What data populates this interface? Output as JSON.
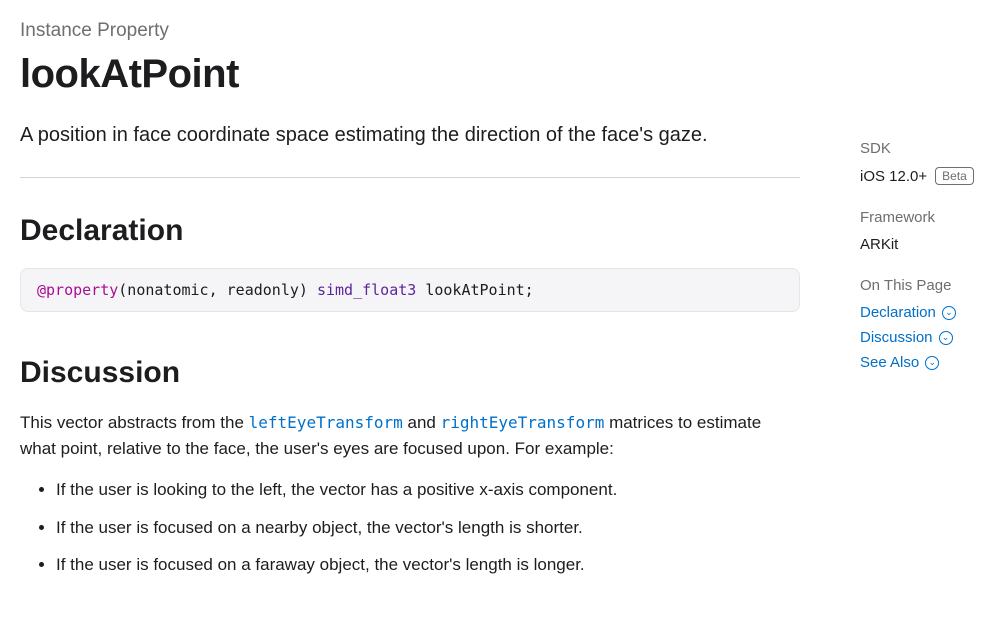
{
  "eyebrow": "Instance Property",
  "title": "lookAtPoint",
  "summary": "A position in face coordinate space estimating the direction of the face's gaze.",
  "sections": {
    "declaration": {
      "heading": "Declaration",
      "code": {
        "keyword": "@property",
        "modifiers": "(nonatomic, readonly) ",
        "type": "simd_float3",
        "rest": " lookAtPoint;"
      }
    },
    "discussion": {
      "heading": "Discussion",
      "intro_pre": "This vector abstracts from the ",
      "link1": "leftEyeTransform",
      "intro_mid": " and ",
      "link2": "rightEyeTransform",
      "intro_post": " matrices to estimate what point, relative to the face, the user's eyes are focused upon. For example:",
      "bullets": [
        "If the user is looking to the left, the vector has a positive x-axis component.",
        "If the user is focused on a nearby object, the vector's length is shorter.",
        "If the user is focused on a faraway object, the vector's length is longer."
      ]
    }
  },
  "sidebar": {
    "sdk": {
      "label": "SDK",
      "value": "iOS 12.0+",
      "badge": "Beta"
    },
    "framework": {
      "label": "Framework",
      "value": "ARKit"
    },
    "onthispage": {
      "label": "On This Page",
      "items": [
        "Declaration",
        "Discussion",
        "See Also"
      ]
    }
  }
}
